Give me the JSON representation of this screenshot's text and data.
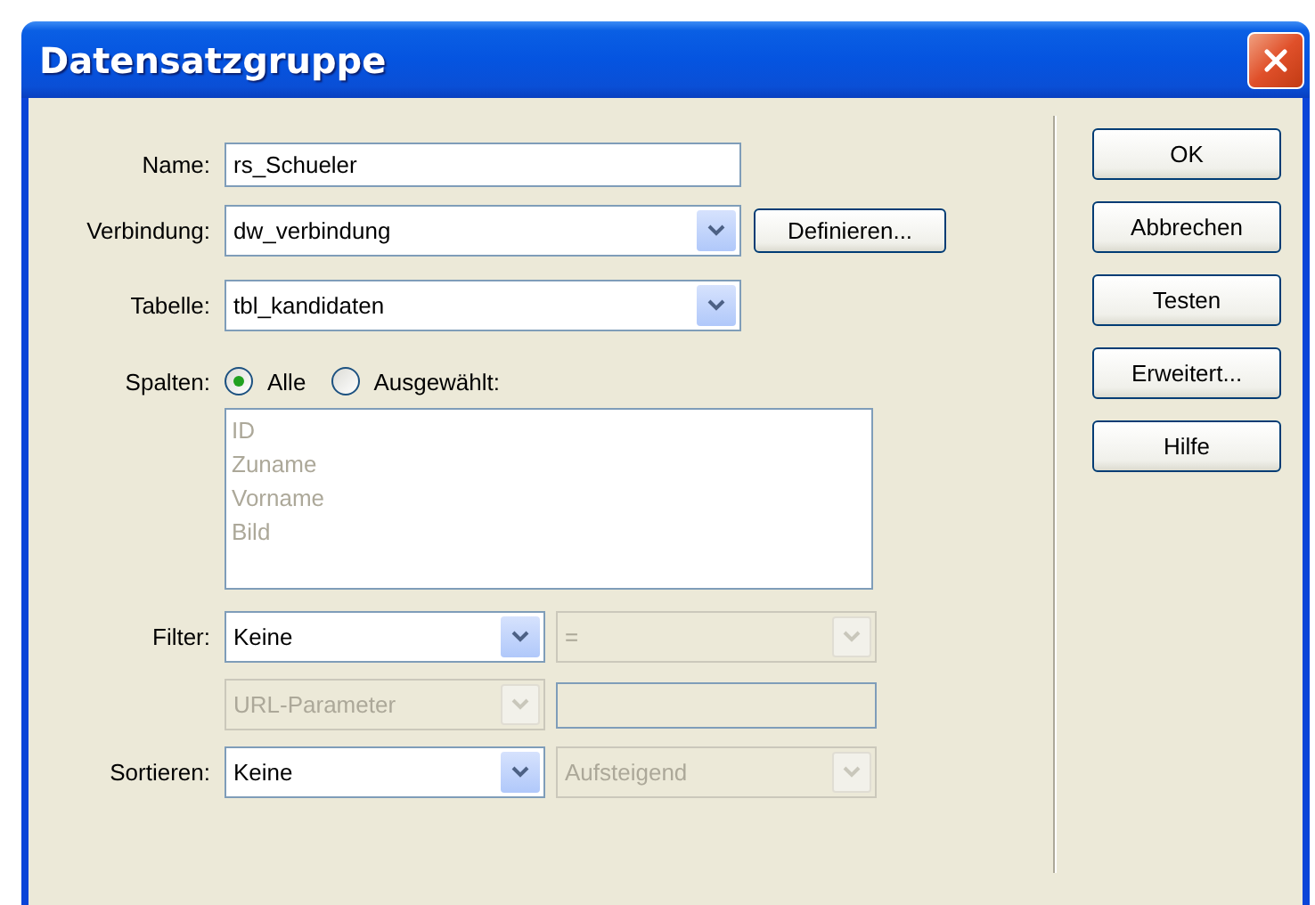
{
  "window": {
    "title": "Datensatzgruppe"
  },
  "name": {
    "label": "Name:",
    "value": "rs_Schueler"
  },
  "connection": {
    "label": "Verbindung:",
    "value": "dw_verbindung",
    "button": "Definieren..."
  },
  "table": {
    "label": "Tabelle:",
    "value": "tbl_kandidaten"
  },
  "columns": {
    "label": "Spalten:",
    "options": [
      {
        "label": "Alle",
        "selected": true
      },
      {
        "label": "Ausgewählt:",
        "selected": false
      }
    ],
    "list_disabled": true,
    "items": [
      "ID",
      "Zuname",
      "Vorname",
      "Bild"
    ]
  },
  "filter": {
    "label": "Filter:",
    "column": {
      "value": "Keine",
      "disabled": false
    },
    "operator": {
      "value": "=",
      "disabled": true
    },
    "source": {
      "value": "URL-Parameter",
      "disabled": true
    },
    "parameter": {
      "disabled": true
    }
  },
  "sort": {
    "label": "Sortieren:",
    "column": {
      "value": "Keine",
      "disabled": false
    },
    "order": {
      "value": "Aufsteigend",
      "disabled": true
    }
  },
  "buttons": [
    "OK",
    "Abbrechen",
    "Testen",
    "Erweitert...",
    "Hilfe"
  ]
}
